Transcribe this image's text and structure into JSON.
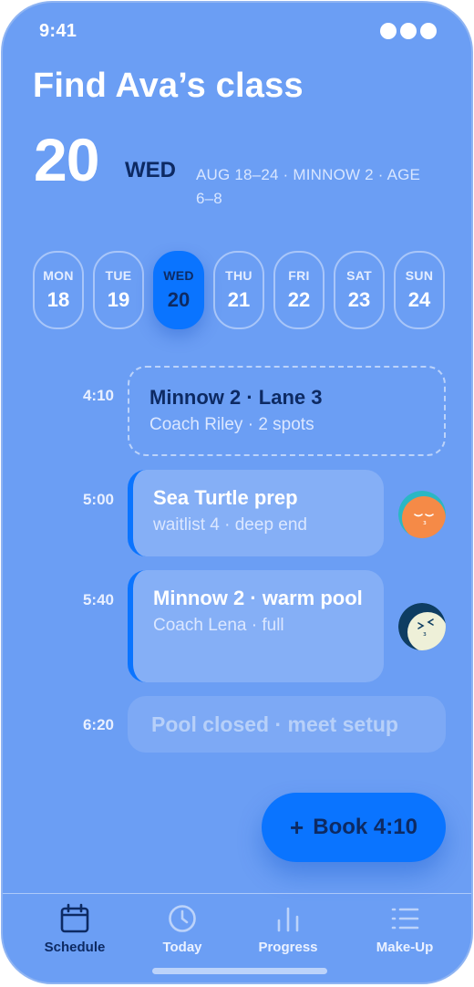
{
  "status": {
    "time": "9:41"
  },
  "header": {
    "title": "Find Ava’s class",
    "day_number": "20",
    "day_of_week": "WED",
    "meta": "AUG 18–24 · MINNOW 2 · AGE 6–8"
  },
  "week": [
    {
      "dow": "MON",
      "num": "18",
      "selected": false
    },
    {
      "dow": "TUE",
      "num": "19",
      "selected": false
    },
    {
      "dow": "WED",
      "num": "20",
      "selected": true
    },
    {
      "dow": "THU",
      "num": "21",
      "selected": false
    },
    {
      "dow": "FRI",
      "num": "22",
      "selected": false
    },
    {
      "dow": "SAT",
      "num": "23",
      "selected": false
    },
    {
      "dow": "SUN",
      "num": "24",
      "selected": false
    }
  ],
  "schedule": [
    {
      "time": "4:10",
      "title": "Minnow 2 · Lane 3",
      "subtitle": "Coach Riley · 2 spots"
    },
    {
      "time": "5:00",
      "title": "Sea Turtle prep",
      "subtitle": "waitlist 4 · deep end"
    },
    {
      "time": "5:40",
      "title": "Minnow 2 · warm pool",
      "subtitle": "Coach Lena · full"
    },
    {
      "time": "6:20",
      "title": "Pool closed · meet setup",
      "subtitle": ""
    }
  ],
  "fab": {
    "label": "Book 4:10",
    "icon": "plus-icon"
  },
  "tabs": [
    {
      "label": "Schedule",
      "icon": "calendar-icon",
      "active": true
    },
    {
      "label": "Today",
      "icon": "clock-icon",
      "active": false
    },
    {
      "label": "Progress",
      "icon": "bar-chart-icon",
      "active": false
    },
    {
      "label": "Make-Up",
      "icon": "list-icon",
      "active": false
    }
  ],
  "colors": {
    "background": "#6b9ef4",
    "accent": "#0a74ff",
    "ink": "#0d2a63",
    "avatar_orange": "#f58a47",
    "avatar_teal": "#2ab7c4",
    "avatar_navy": "#0e3d62",
    "avatar_cream": "#eef0d8"
  }
}
